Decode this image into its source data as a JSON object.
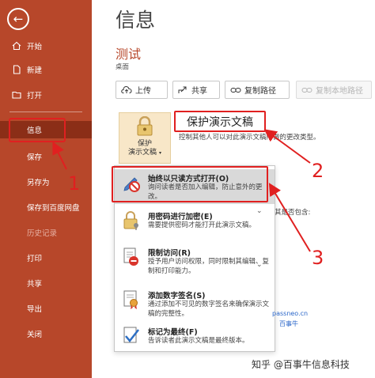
{
  "sidebar": {
    "back": "←",
    "items": [
      {
        "label": "开始"
      },
      {
        "label": "新建"
      },
      {
        "label": "打开"
      },
      {
        "label": "信息"
      },
      {
        "label": "保存"
      },
      {
        "label": "另存为"
      },
      {
        "label": "保存到百度网盘"
      },
      {
        "label": "历史记录"
      },
      {
        "label": "打印"
      },
      {
        "label": "共享"
      },
      {
        "label": "导出"
      },
      {
        "label": "关闭"
      }
    ]
  },
  "main": {
    "title": "信息",
    "doc_name": "测试",
    "doc_location": "桌面",
    "toolbar": {
      "upload": "上传",
      "share": "共享",
      "copy_path": "复制路径",
      "copy_local_path": "复制本地路径"
    },
    "protect": {
      "button_line1": "保护",
      "button_line2": "演示文稿",
      "heading": "保护演示文稿",
      "description": "控制其他人可以对此演示文稿所做的更改类型。"
    },
    "background_fragments": {
      "inspect": "注意其是否包含:",
      "inspect_frag": "名",
      "versions": "改。"
    },
    "menu": [
      {
        "title": "始终以只读方式打开(O)",
        "desc": "询问读者是否加入编辑，防止意外的更改。"
      },
      {
        "title": "用密码进行加密(E)",
        "desc": "需要提供密码才能打开此演示文稿。"
      },
      {
        "title": "限制访问(R)",
        "desc": "授予用户访问权限，同时限制其编辑、复制和打印能力。"
      },
      {
        "title": "添加数字签名(S)",
        "desc": "通过添加不可见的数字签名来确保演示文稿的完整性。"
      },
      {
        "title": "标记为最终(F)",
        "desc": "告诉读者此演示文稿是最终版本。"
      }
    ]
  },
  "annotations": {
    "n1": "1",
    "n2": "2",
    "n3": "3"
  },
  "watermark": {
    "site": "passneo.cn",
    "cn": "百事牛",
    "zhihu": "知乎 @百事牛信息科技"
  },
  "colors": {
    "sidebar": "#b7472a",
    "accent": "#b7472a",
    "annotation": "#e02020"
  }
}
